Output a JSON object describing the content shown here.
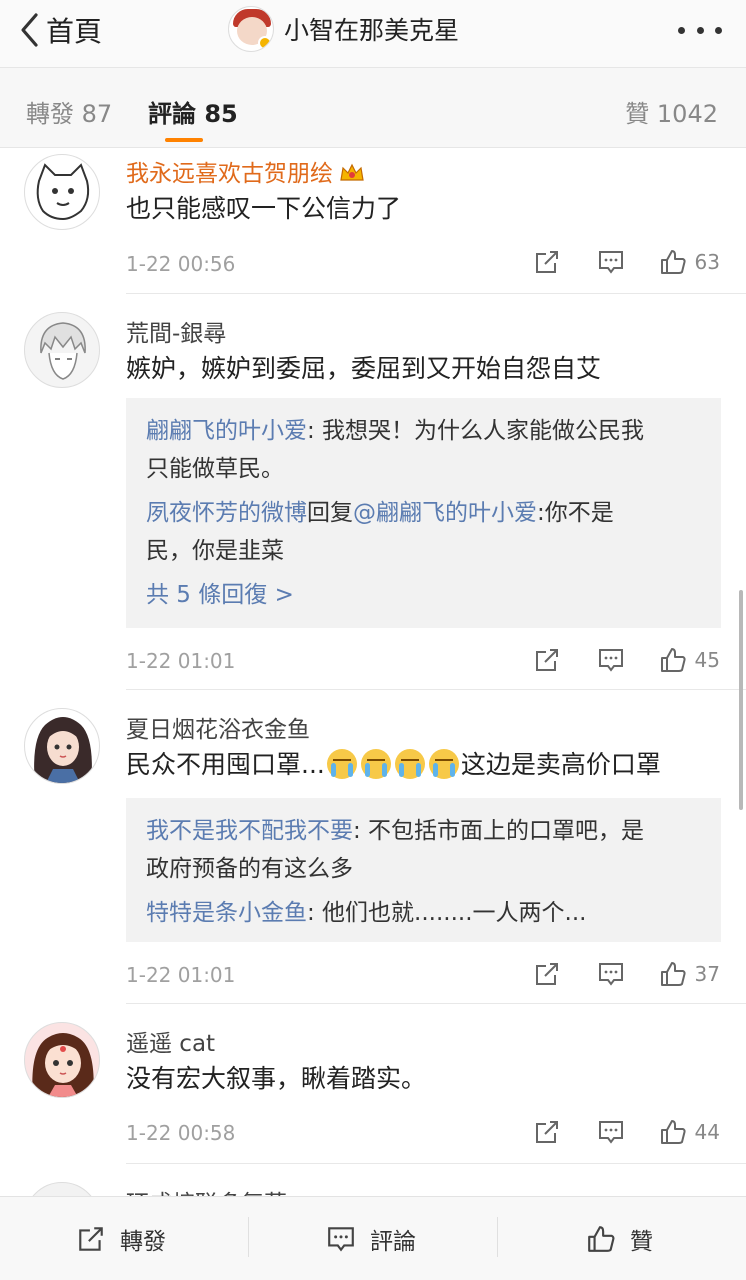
{
  "nav": {
    "back_label": "首頁",
    "title": "小智在那美克星"
  },
  "tabs": {
    "repost": "轉發 87",
    "comments": "評論 85",
    "likes": "贊 1042"
  },
  "comments": [
    {
      "user": "我永远喜欢古贺朋绘",
      "text": "也只能感叹一下公信力了",
      "time": "1-22 00:56",
      "likes": "63"
    },
    {
      "user": "荒間-銀尋",
      "text": "嫉妒，嫉妒到委屈，委屈到又开始自怨自艾",
      "replies": [
        {
          "name": "翩翩飞的叶小爱",
          "body": ": 我想哭！为什么人家能做公民我",
          "body2": "只能做草民。"
        },
        {
          "name": "夙夜怀芳的微博",
          "mid": "回复",
          "at": "@翩翩飞的叶小爱",
          "body": ":你不是",
          "body2": "民，你是韭菜"
        }
      ],
      "more_replies": "共 5 條回復 >",
      "time": "1-22 01:01",
      "likes": "45"
    },
    {
      "user": "夏日烟花浴衣金鱼",
      "text_start": "民众不用囤口罩...",
      "text_end": "这边是卖高价口罩",
      "replies": [
        {
          "name": "我不是我不配我不要",
          "body": ": 不包括市面上的口罩吧，是",
          "body2": "政府预备的有这么多"
        },
        {
          "name": "特特是条小金鱼",
          "body": ": 他们也就........一人两个..."
        }
      ],
      "time": "1-22 01:01",
      "likes": "37"
    },
    {
      "user": "遥遥 cat",
      "text": "没有宏大叙事，瞅着踏实。",
      "time": "1-22 00:58",
      "likes": "44"
    },
    {
      "user": "环成熔联多复菜"
    }
  ],
  "bottom": {
    "repost": "轉發",
    "comment": "評論",
    "like": "贊"
  },
  "colors": {
    "accent": "#ff8200",
    "link": "#5b7cb1",
    "vip_name": "#e06a1b"
  }
}
